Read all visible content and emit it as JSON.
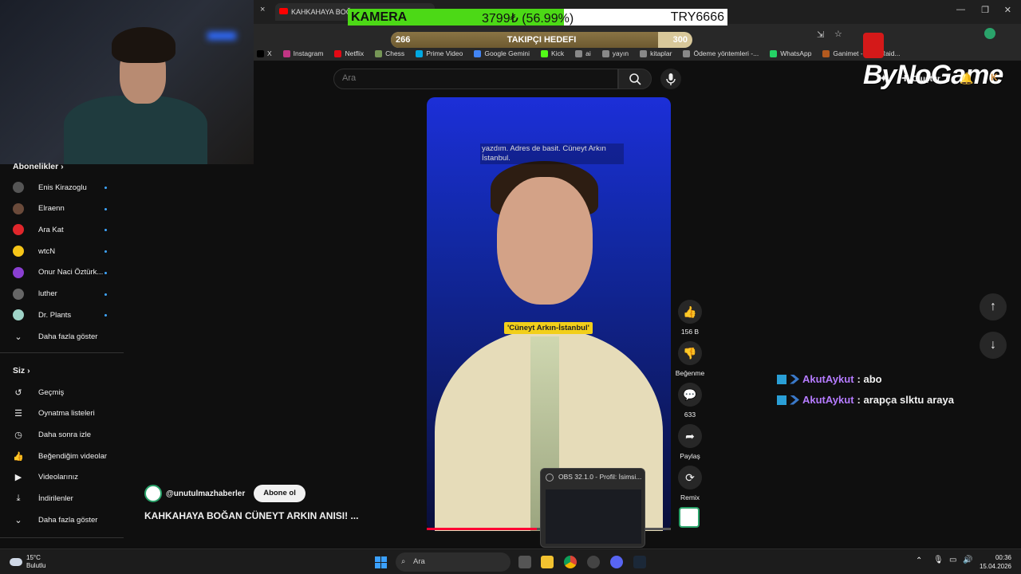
{
  "browser": {
    "tab_title": "KAHKAHAYA BOĞAN",
    "tab_close": "×",
    "bookmarks": [
      {
        "label": "X",
        "color": "#000000"
      },
      {
        "label": "Instagram",
        "color": "#c13584"
      },
      {
        "label": "Netflix",
        "color": "#e50914"
      },
      {
        "label": "Chess",
        "color": "#769656"
      },
      {
        "label": "Prime Video",
        "color": "#00a8e1"
      },
      {
        "label": "Google Gemini",
        "color": "#4285f4"
      },
      {
        "label": "Kick",
        "color": "#53fc18"
      },
      {
        "label": "ai",
        "color": "#888888"
      },
      {
        "label": "yayın",
        "color": "#888888"
      },
      {
        "label": "kitaplar",
        "color": "#888888"
      },
      {
        "label": "Ödeme yöntemleri -...",
        "color": "#888888"
      },
      {
        "label": "WhatsApp",
        "color": "#25d366"
      },
      {
        "label": "Ganimet - ARC Raid...",
        "color": "#b35a1f"
      }
    ]
  },
  "overlay": {
    "goal_label": "KAMERA",
    "goal_amount": "3799₺ (56.99%)",
    "goal_fraction": 0.5699,
    "goal_code": "TRY6666",
    "follower_label": "TAKIPÇI HEDEFI",
    "follower_current": "266",
    "follower_target": "300",
    "follower_fraction": 0.887,
    "brand": "ByNoGame"
  },
  "header": {
    "search_placeholder": "Ara",
    "create_label": "Oluştur"
  },
  "sidebar": {
    "subscriptions_title": "Abonelikler",
    "subscriptions": [
      {
        "label": "Enis Kirazoglu",
        "color": "#555555"
      },
      {
        "label": "Elraenn",
        "color": "#6a4a3a"
      },
      {
        "label": "Ara Kat",
        "color": "#e0262b"
      },
      {
        "label": "wtcN",
        "color": "#f5c518"
      },
      {
        "label": "Onur Naci Öztürk...",
        "color": "#8a3fd1"
      },
      {
        "label": "luther",
        "color": "#666666"
      },
      {
        "label": "Dr. Plants",
        "color": "#9fd3c7"
      }
    ],
    "show_more_subs": "Daha fazla göster",
    "you_title": "Siz",
    "you_items": [
      {
        "label": "Geçmiş",
        "icon": "history-icon"
      },
      {
        "label": "Oynatma listeleri",
        "icon": "playlist-icon"
      },
      {
        "label": "Daha sonra izle",
        "icon": "clock-icon"
      },
      {
        "label": "Beğendiğim videolar",
        "icon": "thumbs-up-icon"
      },
      {
        "label": "Videolarınız",
        "icon": "video-icon"
      },
      {
        "label": "İndirilenler",
        "icon": "download-icon"
      }
    ],
    "show_more_you": "Daha fazla göster"
  },
  "video": {
    "subtitle_top": "yazdım. Adres de basit. Cüneyt Arkın İstanbul.",
    "subtitle_caption": "'Cüneyt Arkın-İstanbul'",
    "progress": 0.45,
    "channel": "@unutulmazhaberler",
    "subscribe": "Abone ol",
    "title": "KAHKAHAYA BOĞAN CÜNEYT ARKIN ANISI! ..."
  },
  "actions": {
    "like_count": "156 B",
    "dislike_label": "Beğenme",
    "comment_count": "633",
    "share_label": "Paylaş",
    "remix_label": "Remix"
  },
  "chat": [
    {
      "user": "AkutAykut",
      "message": ": abo"
    },
    {
      "user": "AkutAykut",
      "message": ": arapça slktu araya"
    }
  ],
  "obs_preview": {
    "title": "OBS 32.1.0 - Profil: İsimsi..."
  },
  "taskbar": {
    "temperature": "15°C",
    "weather": "Bulutlu",
    "search_label": "Ara",
    "time": "00:36",
    "date": "15.04.2026"
  }
}
